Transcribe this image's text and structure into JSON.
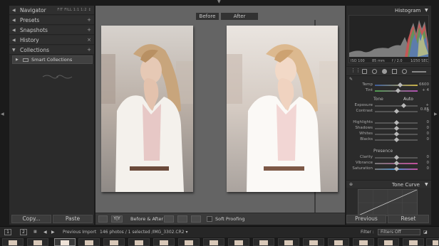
{
  "left_panel": {
    "sections": [
      {
        "label": "Navigator",
        "right": "FIT  FILL  1:1  1:2 ↕"
      },
      {
        "label": "Presets",
        "right": "+"
      },
      {
        "label": "Snapshots",
        "right": "+"
      },
      {
        "label": "History",
        "right": "×"
      },
      {
        "label": "Collections",
        "right": "+"
      }
    ],
    "smart_collections_label": "Smart Collections",
    "copy_button": "Copy...",
    "paste_button": "Paste"
  },
  "center": {
    "before_tab": "Before",
    "after_tab": "After",
    "toolbar": {
      "view_mode": "Y|Y",
      "before_after_label": "Before & After :",
      "soft_proofing_label": "Soft Proofing"
    }
  },
  "right_panel": {
    "histogram_title": "Histogram",
    "histogram_info": {
      "iso": "ISO 100",
      "focal": "85 mm",
      "aperture": "f / 2.0",
      "shutter": "1⁄250 SEC"
    },
    "white_balance": [
      {
        "label": "Temp",
        "value": "6600"
      },
      {
        "label": "Tint",
        "value": "+ 4"
      }
    ],
    "tone_header": "Tone",
    "tone_auto": "Auto",
    "tone": [
      {
        "label": "Exposure",
        "value": "+ 0.85"
      },
      {
        "label": "Contrast",
        "value": "0"
      },
      {
        "label": "Highlights",
        "value": "0"
      },
      {
        "label": "Shadows",
        "value": "0"
      },
      {
        "label": "Whites",
        "value": "0"
      },
      {
        "label": "Blacks",
        "value": "0"
      }
    ],
    "presence_header": "Presence",
    "presence": [
      {
        "label": "Clarity",
        "value": "0"
      },
      {
        "label": "Vibrance",
        "value": "0"
      },
      {
        "label": "Saturation",
        "value": "0"
      }
    ],
    "tone_curve_title": "Tone Curve",
    "previous_button": "Previous",
    "reset_button": "Reset"
  },
  "filmstrip_bar": {
    "screen_1": "1",
    "screen_2": "2",
    "source": "Previous Import",
    "count": "146 photos / 1 selected /IMG_3302.CR2 ▾",
    "filter_label": "Filter :",
    "filter_value": "Filters Off"
  },
  "colors": {
    "accent": "#d7d7d7",
    "panel": "#2b2b2b",
    "canvas": "#646464"
  }
}
